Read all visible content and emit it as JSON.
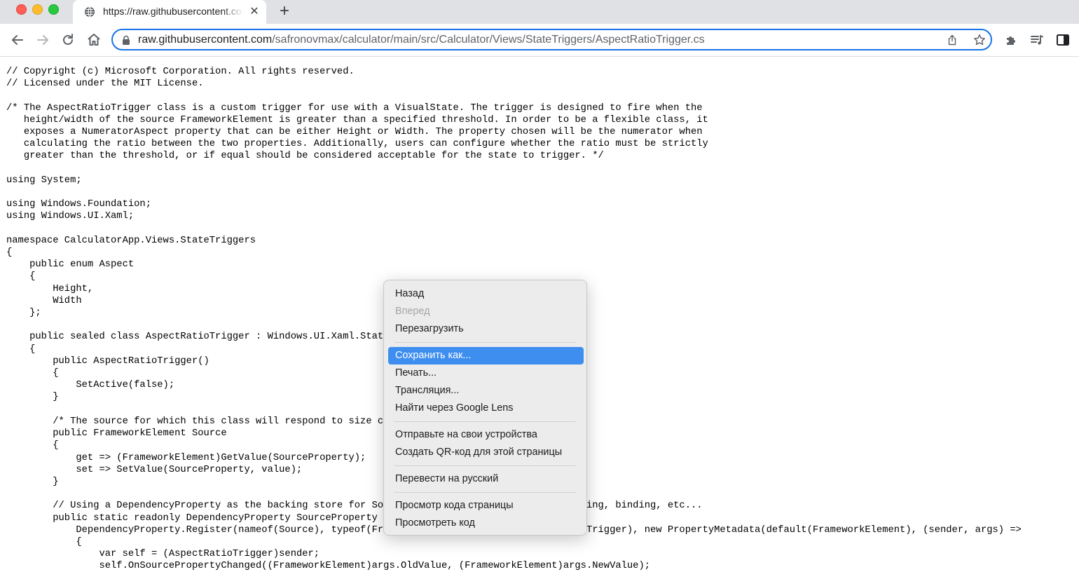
{
  "tab": {
    "title": "https://raw.githubusercontent.com/safronovmax/calculator/main/src/Calculator/Views/StateTriggers/AspectRatioTrigger.cs",
    "close_glyph": "✕",
    "new_tab_glyph": "+"
  },
  "omnibox": {
    "host": "raw.githubusercontent.com",
    "path": "/safronovmax/calculator/main/src/Calculator/Views/StateTriggers/AspectRatioTrigger.cs"
  },
  "icons": {
    "back": "arrow-left-icon",
    "forward": "arrow-right-icon",
    "reload": "reload-icon",
    "home": "home-icon",
    "lock": "lock-icon",
    "share": "share-icon",
    "bookmark": "star-icon",
    "extensions": "puzzle-icon",
    "media": "media-queue-icon",
    "sidepanel": "side-panel-icon"
  },
  "code": "// Copyright (c) Microsoft Corporation. All rights reserved.\n// Licensed under the MIT License.\n\n/* The AspectRatioTrigger class is a custom trigger for use with a VisualState. The trigger is designed to fire when the\n   height/width of the source FrameworkElement is greater than a specified threshold. In order to be a flexible class, it\n   exposes a NumeratorAspect property that can be either Height or Width. The property chosen will be the numerator when\n   calculating the ratio between the two properties. Additionally, users can configure whether the ratio must be strictly\n   greater than the threshold, or if equal should be considered acceptable for the state to trigger. */\n\nusing System;\n\nusing Windows.Foundation;\nusing Windows.UI.Xaml;\n\nnamespace CalculatorApp.Views.StateTriggers\n{\n    public enum Aspect\n    {\n        Height,\n        Width\n    };\n\n    public sealed class AspectRatioTrigger : Windows.UI.Xaml.StateTriggerBase\n    {\n        public AspectRatioTrigger()\n        {\n            SetActive(false);\n        }\n\n        /* The source for which this class will respond to size changed events. */\n        public FrameworkElement Source\n        {\n            get => (FrameworkElement)GetValue(SourceProperty);\n            set => SetValue(SourceProperty, value);\n        }\n\n        // Using a DependencyProperty as the backing store for Source.  This enables animation, styling, binding, etc...\n        public static readonly DependencyProperty SourceProperty =\n            DependencyProperty.Register(nameof(Source), typeof(FrameworkElement), typeof(AspectRatioTrigger), new PropertyMetadata(default(FrameworkElement), (sender, args) =>\n            {\n                var self = (AspectRatioTrigger)sender;\n                self.OnSourcePropertyChanged((FrameworkElement)args.OldValue, (FrameworkElement)args.NewValue);",
  "context_menu": {
    "items": [
      {
        "label": "Назад"
      },
      {
        "label": "Вперед"
      },
      {
        "label": "Перезагрузить"
      },
      {
        "label": "Сохранить как..."
      },
      {
        "label": "Печать..."
      },
      {
        "label": "Трансляция..."
      },
      {
        "label": "Найти через Google Lens"
      },
      {
        "label": "Отправьте на свои устройства"
      },
      {
        "label": "Создать QR-код для этой страницы"
      },
      {
        "label": "Перевести на русский"
      },
      {
        "label": "Просмотр кода страницы"
      },
      {
        "label": "Просмотреть код"
      }
    ],
    "highlight_color": "#3e8ef0"
  }
}
